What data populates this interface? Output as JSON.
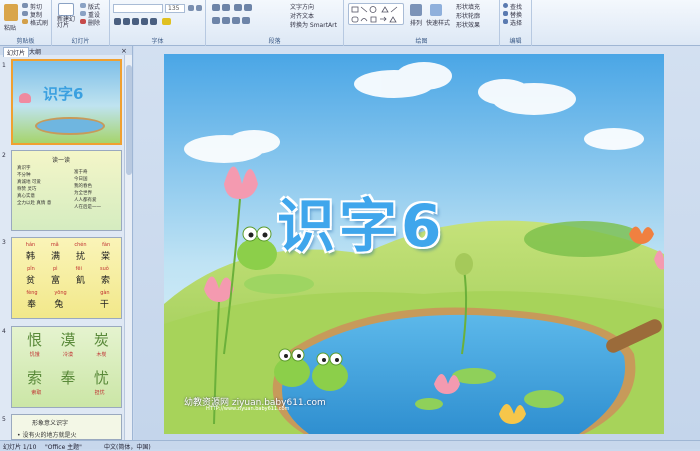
{
  "ribbon": {
    "clipboard": {
      "paste": "粘贴",
      "cut": "剪切",
      "copy": "复制",
      "format_painter": "格式刷",
      "label": "剪贴板"
    },
    "slides": {
      "new_slide": "新建幻灯片",
      "layout": "版式",
      "reset": "重设",
      "delete": "删除",
      "label": "幻灯片"
    },
    "font": {
      "font_name": "",
      "font_size": "135",
      "label": "字体"
    },
    "paragraph": {
      "text_direction": "文字方向",
      "align_text": "对齐文本",
      "smartart": "转换为 SmartArt",
      "label": "段落"
    },
    "drawing": {
      "arrange": "排列",
      "quick_styles": "快速样式",
      "shape_fill": "形状填充",
      "shape_outline": "形状轮廓",
      "shape_effects": "形状效果",
      "label": "绘图"
    },
    "editing": {
      "find": "查找",
      "replace": "替换",
      "select": "选择",
      "label": "编辑"
    }
  },
  "pane": {
    "tabs": [
      "幻灯片",
      "大纲"
    ],
    "thumbs": [
      {
        "num": "1",
        "title": "识字6"
      },
      {
        "num": "2",
        "title": "读一读",
        "col_left": [
          "真识字",
          "不分种",
          "真诚地 可爱",
          "称赞  灵巧",
          "真心实意",
          "全力以赴 真情 意"
        ],
        "col_right": [
          "富于奇",
          "今日国",
          "我的春色",
          "为全世界",
          "人人都有爱",
          "人在后是一一"
        ]
      },
      {
        "num": "3",
        "pinyin1": [
          "hán",
          "mǎ",
          "chén",
          "fàn"
        ],
        "row1": [
          "韩",
          "满",
          "扰",
          "棠"
        ],
        "pinyin2": [
          "pǐn",
          "pì",
          "fēi",
          "suǒ"
        ],
        "row2": [
          "贫",
          "富",
          "飢",
          "索"
        ],
        "pinyin3": [
          "fèng",
          "yōng",
          "",
          "gàn"
        ],
        "row3": [
          "奉",
          "兔",
          "",
          "干"
        ]
      },
      {
        "num": "4",
        "big1": [
          "恨",
          "漠",
          "炭"
        ],
        "small1": [
          "饥饿",
          "冷漠",
          "木炭"
        ],
        "big2": [
          "索",
          "奉",
          "忧"
        ],
        "small2": [
          "索取",
          "",
          "担忧"
        ]
      },
      {
        "num": "5",
        "title": "形象意义识字",
        "line": "• 没有火的地方就是火"
      }
    ]
  },
  "slide": {
    "title": "识字6",
    "watermark": "幼教资源网 ziyuan.baby611.com",
    "watermark_sub": "HTTP://www.ziyuan.baby611.com"
  },
  "status": {
    "slide_of": "幻灯片 1/10",
    "theme": "\"Office 主题\"",
    "language": "中文(简体，中国)"
  }
}
